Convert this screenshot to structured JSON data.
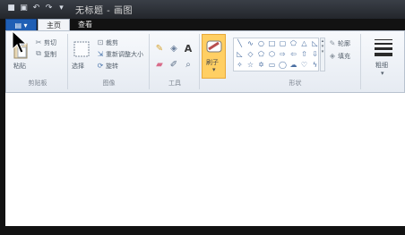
{
  "window": {
    "title": "无标题 - 画图"
  },
  "menu": {
    "label": "▤ ▾"
  },
  "tabs": [
    {
      "label": "主页",
      "active": true
    },
    {
      "label": "查看",
      "active": false
    }
  ],
  "groups": {
    "clipboard": {
      "label": "剪贴板",
      "paste": "粘贴",
      "cut": "剪切",
      "copy": "复制"
    },
    "image": {
      "label": "图像",
      "select": "选择",
      "crop": "裁剪",
      "resize": "重新调整大小",
      "rotate": "旋转"
    },
    "tools": {
      "label": "工具"
    },
    "brush": {
      "label": "刷子"
    },
    "shapes": {
      "label": "形状",
      "outline": "轮廓",
      "fill": "填充"
    },
    "size": {
      "label": "粗细"
    }
  },
  "colors": {
    "accent": "#1f5fb5",
    "brush_bg": "#ffcf63"
  }
}
